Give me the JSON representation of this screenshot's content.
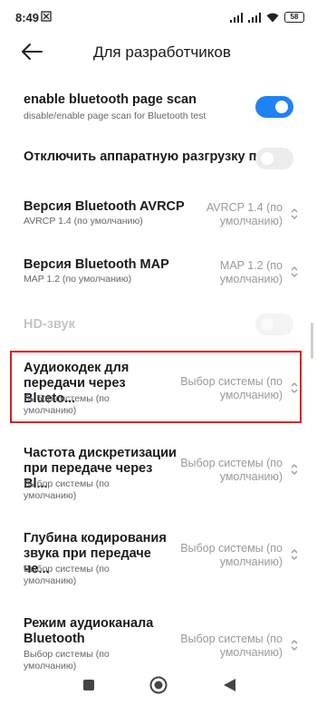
{
  "status_bar": {
    "time": "8:49",
    "battery": "58",
    "icons": [
      "sync-icon",
      "signal-icon",
      "signal-icon",
      "wifi-icon",
      "battery-icon"
    ]
  },
  "app_bar": {
    "title": "Для разработчиков"
  },
  "settings": [
    {
      "title": "enable bluetooth page scan",
      "subtitle": "disable/enable page scan for Bluetooth test",
      "toggle": "on"
    },
    {
      "title": "Отключить аппаратную разгрузку п...",
      "toggle": "off"
    },
    {
      "title": "Версия Bluetooth AVRCP",
      "subtitle": "AVRCP 1.4 (по умолчанию)",
      "value": "AVRCP 1.4 (по умолчанию)"
    },
    {
      "title": "Версия Bluetooth MAP",
      "subtitle": "MAP 1.2 (по умолчанию)",
      "value": "MAP 1.2 (по умолчанию)"
    },
    {
      "title": "HD-звук",
      "toggle": "disabled"
    },
    {
      "title": "Аудиокодек для передачи через Blueto...",
      "subtitle": "Выбор системы (по умолчанию)",
      "value": "Выбор системы (по умолчанию)",
      "highlighted": true
    },
    {
      "title": "Частота дискретизации при передаче через Bl...",
      "subtitle": "Выбор системы (по умолчанию)",
      "value": "Выбор системы (по умолчанию)"
    },
    {
      "title": "Глубина кодирования звука при передаче че...",
      "subtitle": "Выбор системы (по умолчанию)",
      "value": "Выбор системы (по умолчанию)"
    },
    {
      "title": "Режим аудиоканала Bluetooth",
      "subtitle": "Выбор системы (по умолчанию)",
      "value": "Выбор системы (по умолчанию)"
    }
  ],
  "nav_bar": {
    "buttons": [
      "recents-square-icon",
      "home-circle-icon",
      "back-triangle-icon"
    ]
  },
  "colors": {
    "accent": "#1f82f4",
    "highlight_border": "#e0191d",
    "secondary_text": "#9a9a9a"
  }
}
